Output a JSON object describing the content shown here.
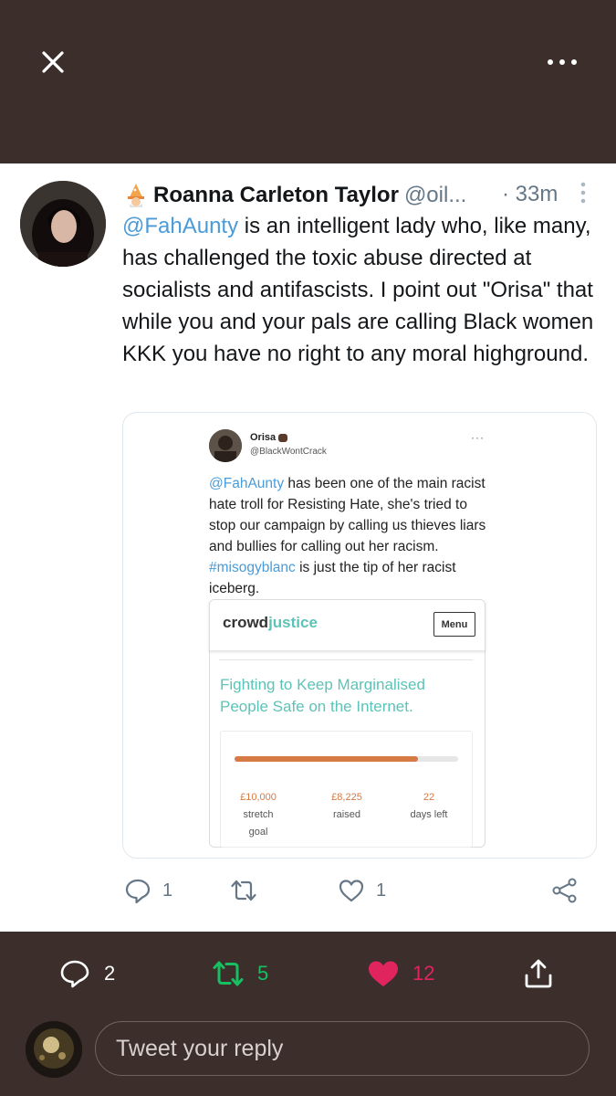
{
  "nav": {
    "close_icon": "close-icon",
    "more_icon": "more-horizontal-icon"
  },
  "tweet": {
    "author_name": "Roanna Carleton Taylor",
    "author_emoji": "wizard-emoji",
    "handle": "@oil...",
    "time": "· 33m",
    "text_mention": "@FahAunty",
    "text_rest": " is an intelligent lady who, like many, has challenged the toxic abuse directed at socialists and antifascists. I point out \"Orisa\" that while you and your pals are calling Black women KKK you have no right to any moral highground."
  },
  "quoted": {
    "name": "Orisa",
    "handle": "@BlackWontCrack",
    "dots": "···",
    "mention": "@FahAunty",
    "text_a": " has been one of the main racist hate troll for Resisting Hate, she's tried to stop our campaign by calling us thieves liars and bullies for calling out her racism. ",
    "hashtag": "#misogyblanc",
    "text_b": " is just the tip of her racist iceberg.",
    "crowdjustice": {
      "logo_a": "crowd",
      "logo_b": "justice",
      "menu": "Menu",
      "title": "Fighting to Keep Marginalised People Safe on the Internet.",
      "progress_fraction": 0.82,
      "stretch_value": "£10,000",
      "stretch_label_1": "stretch",
      "stretch_label_2": "goal",
      "raised_value": "£8,225",
      "raised_label": "raised",
      "days_value": "22",
      "days_label": "days left"
    }
  },
  "tweet_actions": {
    "reply_count": "1",
    "like_count": "1"
  },
  "stats": {
    "replies": "2",
    "retweets": "5",
    "likes": "12",
    "retweet_color": "#17bf63",
    "like_color": "#e0245e"
  },
  "reply": {
    "placeholder": "Tweet your reply"
  }
}
